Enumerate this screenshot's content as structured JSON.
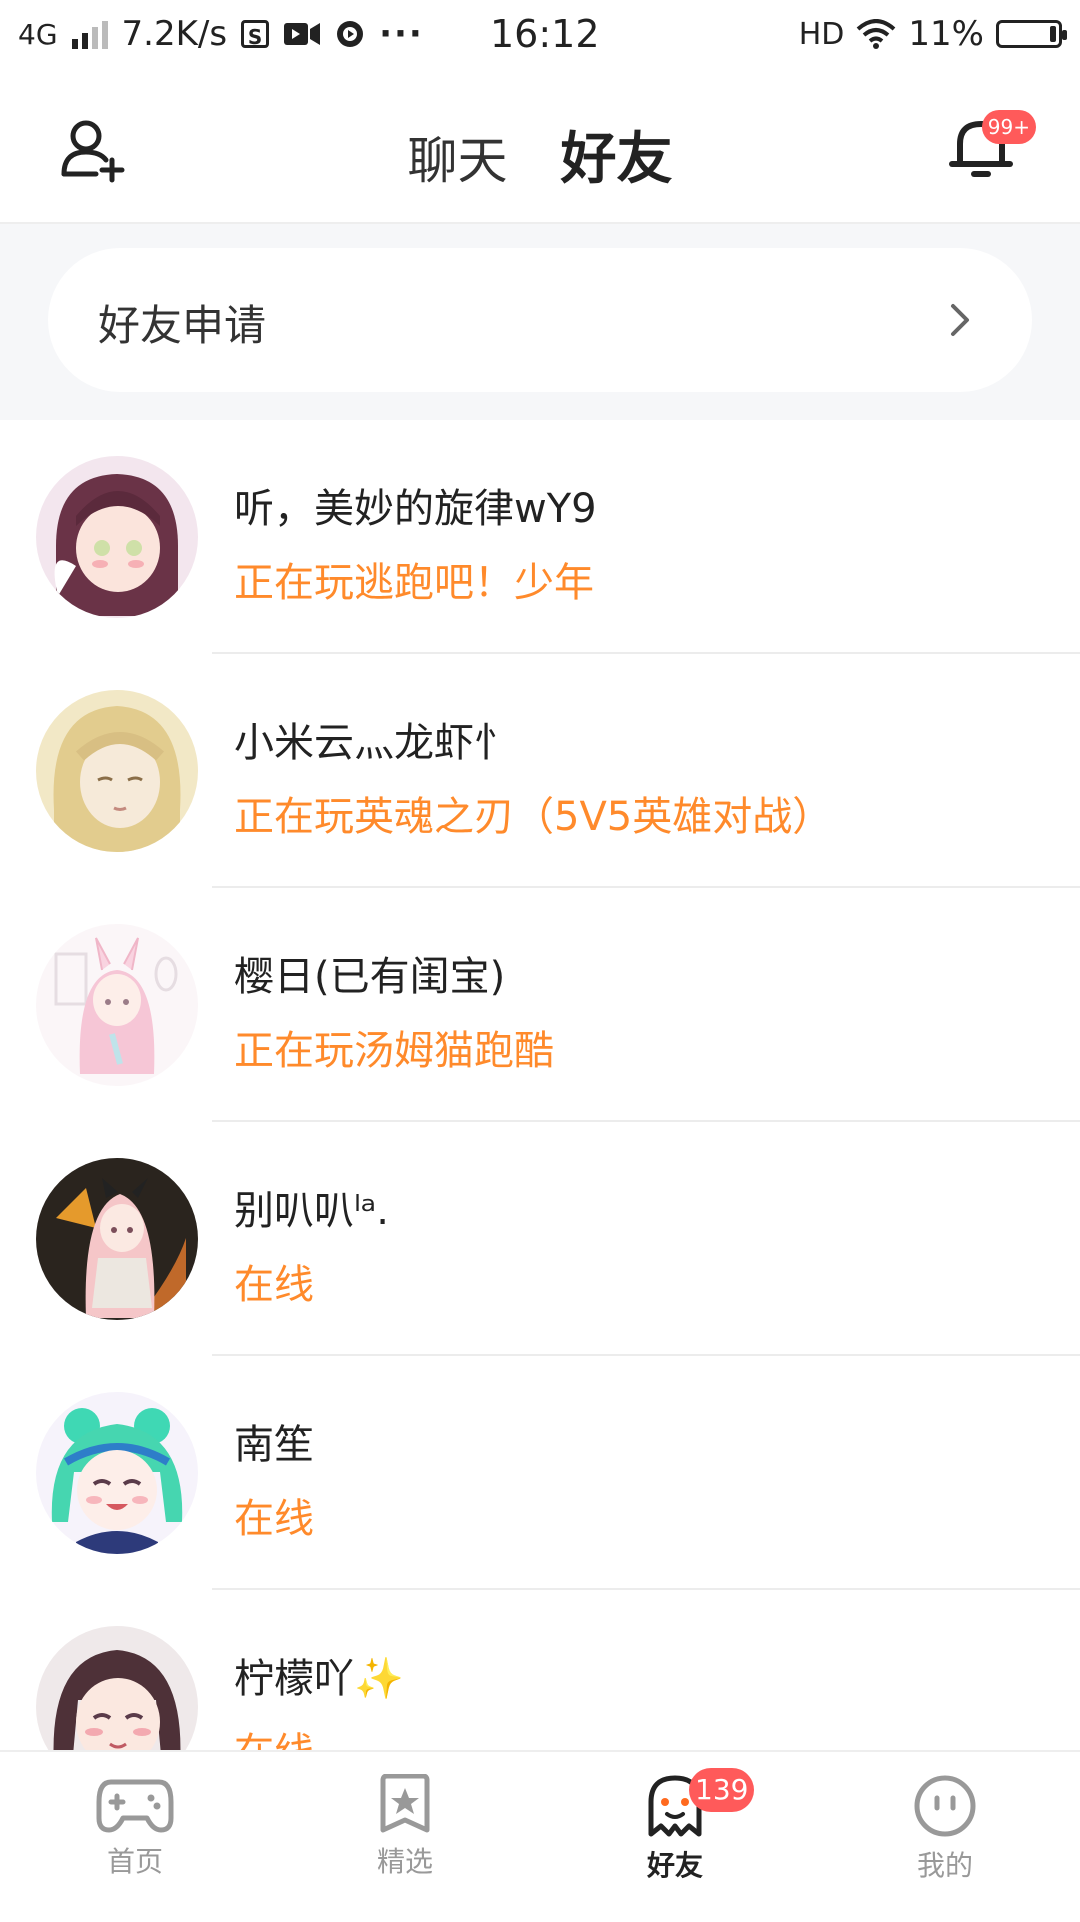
{
  "status_bar": {
    "network": "4G",
    "speed": "7.2K/s",
    "time": "16:12",
    "hd": "HD",
    "battery_pct": "11%"
  },
  "header": {
    "tabs": [
      {
        "label": "聊天",
        "active": false
      },
      {
        "label": "好友",
        "active": true
      }
    ],
    "notification_badge": "99+"
  },
  "friend_request": {
    "label": "好友申请"
  },
  "friends": [
    {
      "name": "听，美妙的旋律wY9",
      "status": "正在玩逃跑吧！少年"
    },
    {
      "name": "小米云灬龙虾忄",
      "status": "正在玩英魂之刃（5V5英雄对战）"
    },
    {
      "name": "樱日(已有闺宝)",
      "status": "正在玩汤姆猫跑酷"
    },
    {
      "name": "别叭叭ˡᵃ.",
      "status": "在线"
    },
    {
      "name": "南笙",
      "status": "在线"
    },
    {
      "name": "柠檬吖✨",
      "status": "在线"
    }
  ],
  "bottom_nav": {
    "items": [
      {
        "label": "首页",
        "icon": "gamepad-icon"
      },
      {
        "label": "精选",
        "icon": "star-bookmark-icon"
      },
      {
        "label": "好友",
        "icon": "ghost-icon",
        "badge": "139",
        "active": true
      },
      {
        "label": "我的",
        "icon": "face-icon"
      }
    ]
  },
  "colors": {
    "accent": "#ff5a1f",
    "status_text": "#ff8a2b",
    "badge": "#ff5a5a"
  }
}
